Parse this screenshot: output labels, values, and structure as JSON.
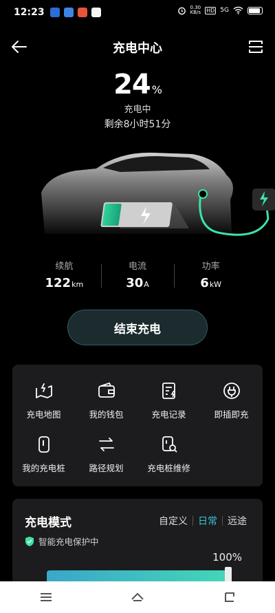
{
  "status_bar": {
    "time": "12:23",
    "net_speed_value": "0.30",
    "net_speed_unit": "KB/s",
    "hd": "HD",
    "signal": "5G",
    "app_icons": [
      "#2a6fd6",
      "#3f84e5",
      "#e8553a",
      "#f5f5f5"
    ]
  },
  "header": {
    "title": "充电中心",
    "back_icon": "arrow-left-icon",
    "scan_icon": "scan-icon"
  },
  "charge": {
    "percent": "24",
    "percent_unit": "%",
    "status": "充电中",
    "remaining": "剩余8小时51分",
    "level_fraction": 0.24
  },
  "stats": [
    {
      "label": "续航",
      "value": "122",
      "unit": "km"
    },
    {
      "label": "电流",
      "value": "30",
      "unit": "A"
    },
    {
      "label": "功率",
      "value": "6",
      "unit": "kW"
    }
  ],
  "end_button": {
    "label": "结束充电"
  },
  "grid": [
    {
      "label": "充电地图",
      "icon": "map-charger-icon"
    },
    {
      "label": "我的钱包",
      "icon": "wallet-icon"
    },
    {
      "label": "充电记录",
      "icon": "records-icon"
    },
    {
      "label": "即插即充",
      "icon": "plug-charge-icon"
    },
    {
      "label": "我的充电桩",
      "icon": "charger-pile-icon"
    },
    {
      "label": "路径规划",
      "icon": "route-icon"
    },
    {
      "label": "充电桩维修",
      "icon": "repair-icon"
    }
  ],
  "mode": {
    "title": "充电模式",
    "tabs": [
      "自定义",
      "日常",
      "远途"
    ],
    "active_tab": "日常",
    "protection": "智能充电保护中",
    "limit_label": "100%",
    "limit_fraction": 1.0
  },
  "colors": {
    "accent": "#36c6d6",
    "green": "#3de3a5",
    "card": "#1c1c1e"
  },
  "navbar": {
    "icons": [
      "menu-icon",
      "home-icon",
      "back-icon"
    ]
  }
}
